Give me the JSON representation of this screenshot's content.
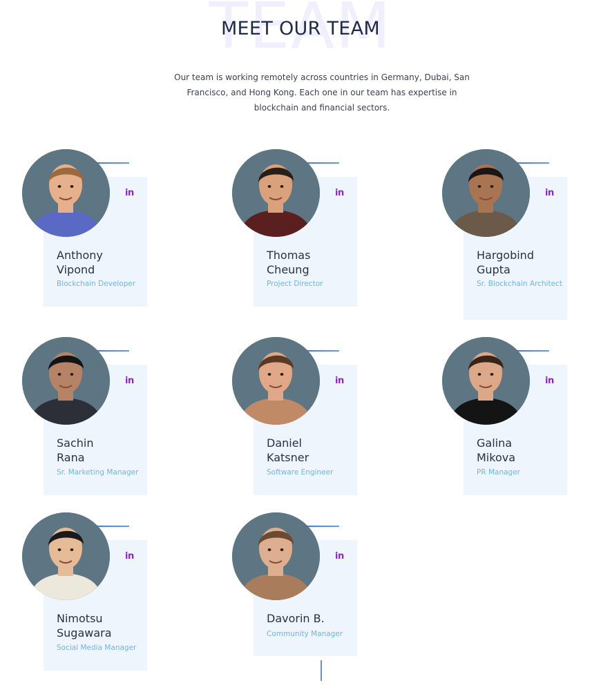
{
  "section": {
    "watermark": "TEAM",
    "title": "MEET OUR TEAM",
    "description": "Our team is working remotely across countries in Germany, Dubai, San Francisco, and Hong Kong. Each one in our team has expertise in blockchain and financial sectors."
  },
  "social_label": "in",
  "members": [
    {
      "name_line1": "Anthony",
      "name_line2": "Vipond",
      "role": "Blockchain Developer",
      "avatar": {
        "skin": "#e7b08c",
        "hair": "#9a6a3c",
        "shirt": "#5a6ac4"
      }
    },
    {
      "name_line1": "Thomas",
      "name_line2": "Cheung",
      "role": "Project Director",
      "avatar": {
        "skin": "#d9a27d",
        "hair": "#2a1d16",
        "shirt": "#5b1f1f"
      }
    },
    {
      "name_line1": "Hargobind",
      "name_line2": "Gupta",
      "role": "Sr. Blockchain Architect",
      "avatar": {
        "skin": "#a87452",
        "hair": "#1c1512",
        "shirt": "#6b5a4a"
      }
    },
    {
      "name_line1": "Sachin",
      "name_line2": "Rana",
      "role": "Sr. Marketing Manager",
      "avatar": {
        "skin": "#b58466",
        "hair": "#141414",
        "shirt": "#2c2f38"
      }
    },
    {
      "name_line1": "Daniel",
      "name_line2": "Katsner",
      "role": "Software Engineer",
      "avatar": {
        "skin": "#e0a888",
        "hair": "#5a3a22",
        "shirt": "#c08a66"
      }
    },
    {
      "name_line1": "Galina",
      "name_line2": "Mikova",
      "role": "PR Manager",
      "avatar": {
        "skin": "#dba88a",
        "hair": "#3a2418",
        "shirt": "#141414"
      }
    },
    {
      "name_line1": "Nimotsu",
      "name_line2": "Sugawara",
      "role": "Social Media Manager",
      "avatar": {
        "skin": "#e6bb98",
        "hair": "#1a1a1a",
        "shirt": "#ede8dc"
      }
    },
    {
      "name_line1": "Davorin B.",
      "name_line2": "",
      "role": "Community Manager",
      "avatar": {
        "skin": "#deae90",
        "hair": "#6a4a30",
        "shirt": "#a97c5c"
      }
    }
  ],
  "theme": {
    "card_bg": "#eef5fd",
    "accent_line": "#2f7de1",
    "linkedin_color": "#8a2bb8",
    "role_color": "#6fb4e4",
    "avatar_bg": "#5e7684"
  }
}
